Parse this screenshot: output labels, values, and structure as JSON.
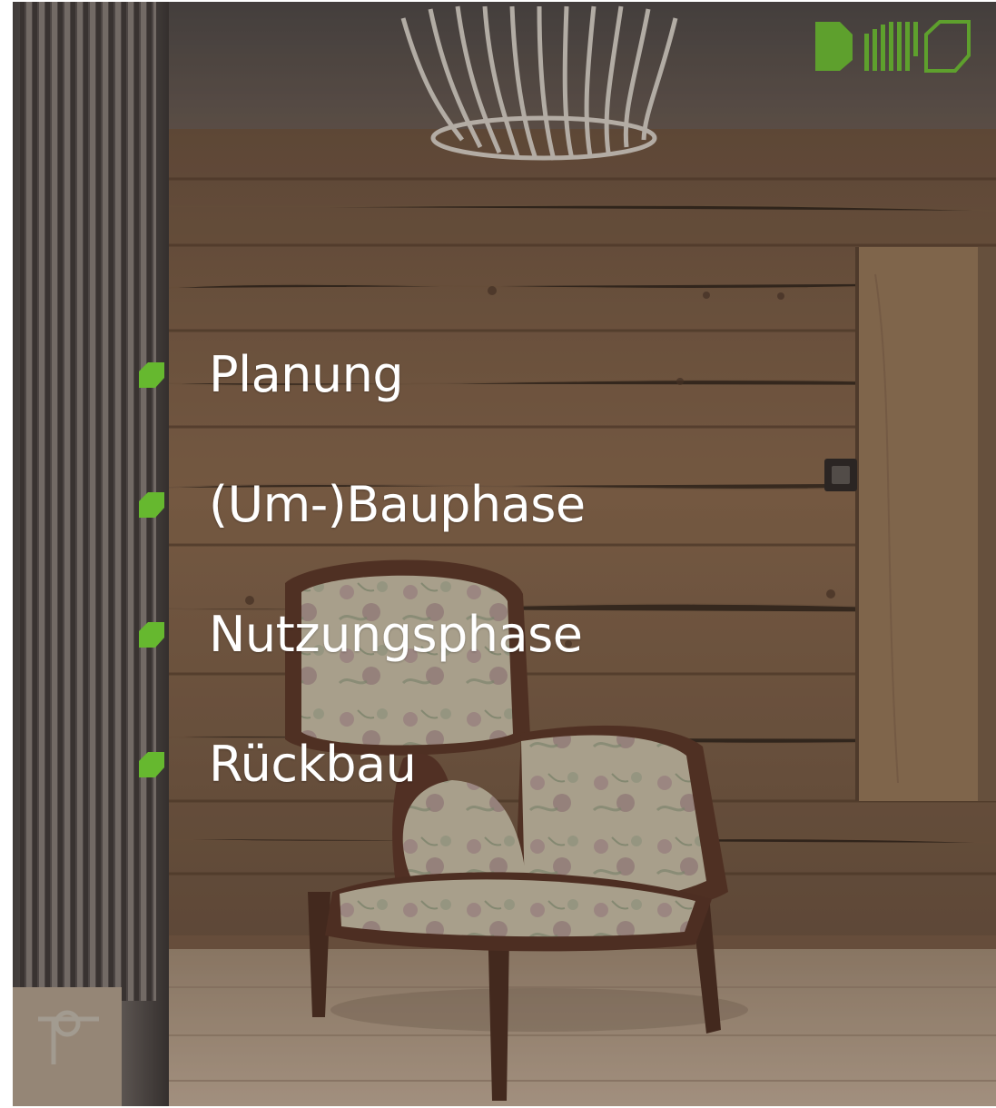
{
  "image": {
    "description_colors": {
      "accent_green": "#5ea02d",
      "bullet_green": "#66b82f",
      "wall_wood": "#8a6a4d",
      "floor_wood": "#b79f86",
      "text_white": "#ffffff"
    }
  },
  "logo": {
    "icons": [
      "filled-hexagon-icon",
      "striped-hexagon-icon",
      "outline-hexagon-icon"
    ]
  },
  "phases": {
    "items": [
      {
        "label": "Planung"
      },
      {
        "label": "(Um-)Bauphase"
      },
      {
        "label": "Nutzungsphase"
      },
      {
        "label": "Rückbau"
      }
    ]
  }
}
